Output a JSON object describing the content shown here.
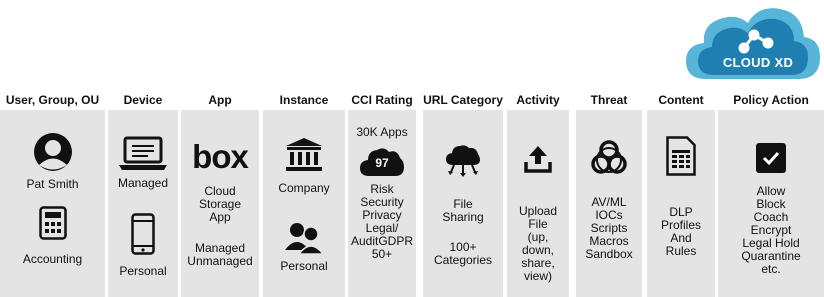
{
  "logo": {
    "text": "CLOUD XD"
  },
  "columns": [
    {
      "header": "User, Group, OU",
      "items": [
        "Pat Smith",
        "Accounting"
      ]
    },
    {
      "header": "Device",
      "items": [
        "Managed",
        "Personal"
      ]
    },
    {
      "header": "App",
      "brand": "box",
      "items": [
        "Cloud",
        "Storage",
        "App",
        "Managed",
        "Unmanaged"
      ]
    },
    {
      "header": "Instance",
      "items": [
        "Company",
        "Personal"
      ]
    },
    {
      "header": "CCI Rating",
      "items": [
        "30K Apps",
        "97",
        "Risk",
        "Security",
        "Privacy",
        "Legal/",
        "AuditGDPR",
        "50+"
      ]
    },
    {
      "header": "URL Category",
      "items": [
        "File",
        "Sharing",
        "100+",
        "Categories"
      ]
    },
    {
      "header": "Activity",
      "items": [
        "Upload",
        "File",
        "(up,",
        "down,",
        "share,",
        "view)"
      ]
    },
    {
      "header": "Threat",
      "items": [
        "AV/ML",
        "IOCs",
        "Scripts",
        "Macros",
        "Sandbox"
      ]
    },
    {
      "header": "Content",
      "items": [
        "DLP",
        "Profiles",
        "And",
        "Rules"
      ]
    },
    {
      "header": "Policy Action",
      "items": [
        "Allow",
        "Block",
        "Coach",
        "Encrypt",
        "Legal Hold",
        "Quarantine",
        "etc."
      ]
    }
  ]
}
